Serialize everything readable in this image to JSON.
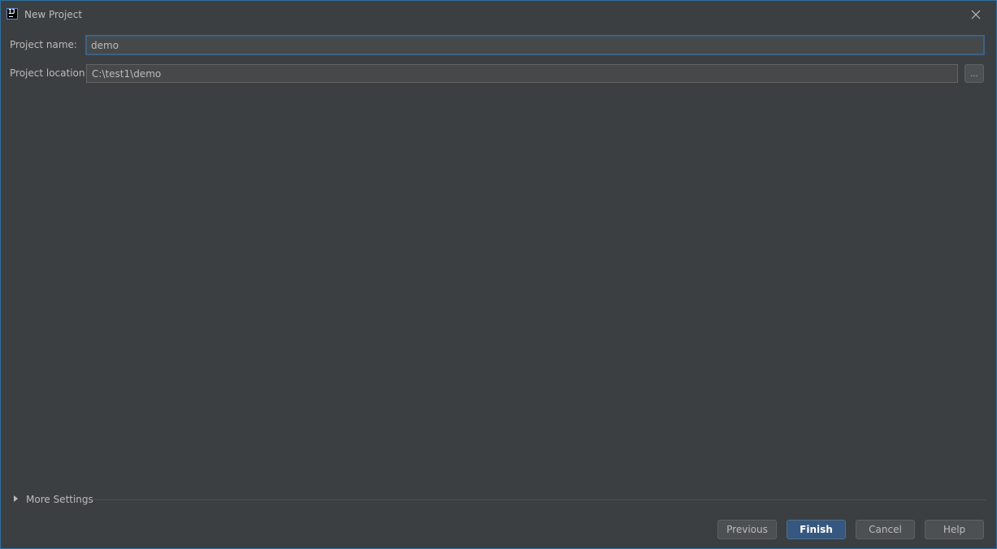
{
  "window": {
    "title": "New Project",
    "app_icon_text": "IJ"
  },
  "form": {
    "project_name": {
      "label": "Project name:",
      "value": "demo"
    },
    "project_location": {
      "label": "Project location:",
      "value": "C:\\test1\\demo",
      "browse_label": "..."
    }
  },
  "more_settings": {
    "label": "More Settings",
    "expanded": false
  },
  "buttons": {
    "previous": "Previous",
    "finish": "Finish",
    "cancel": "Cancel",
    "help": "Help"
  },
  "colors": {
    "background": "#3c3f41",
    "input_background": "#45494a",
    "focus_border": "#3d6185",
    "primary_button": "#365880",
    "window_border": "#2f6f9f",
    "text": "#bbbbbb"
  }
}
